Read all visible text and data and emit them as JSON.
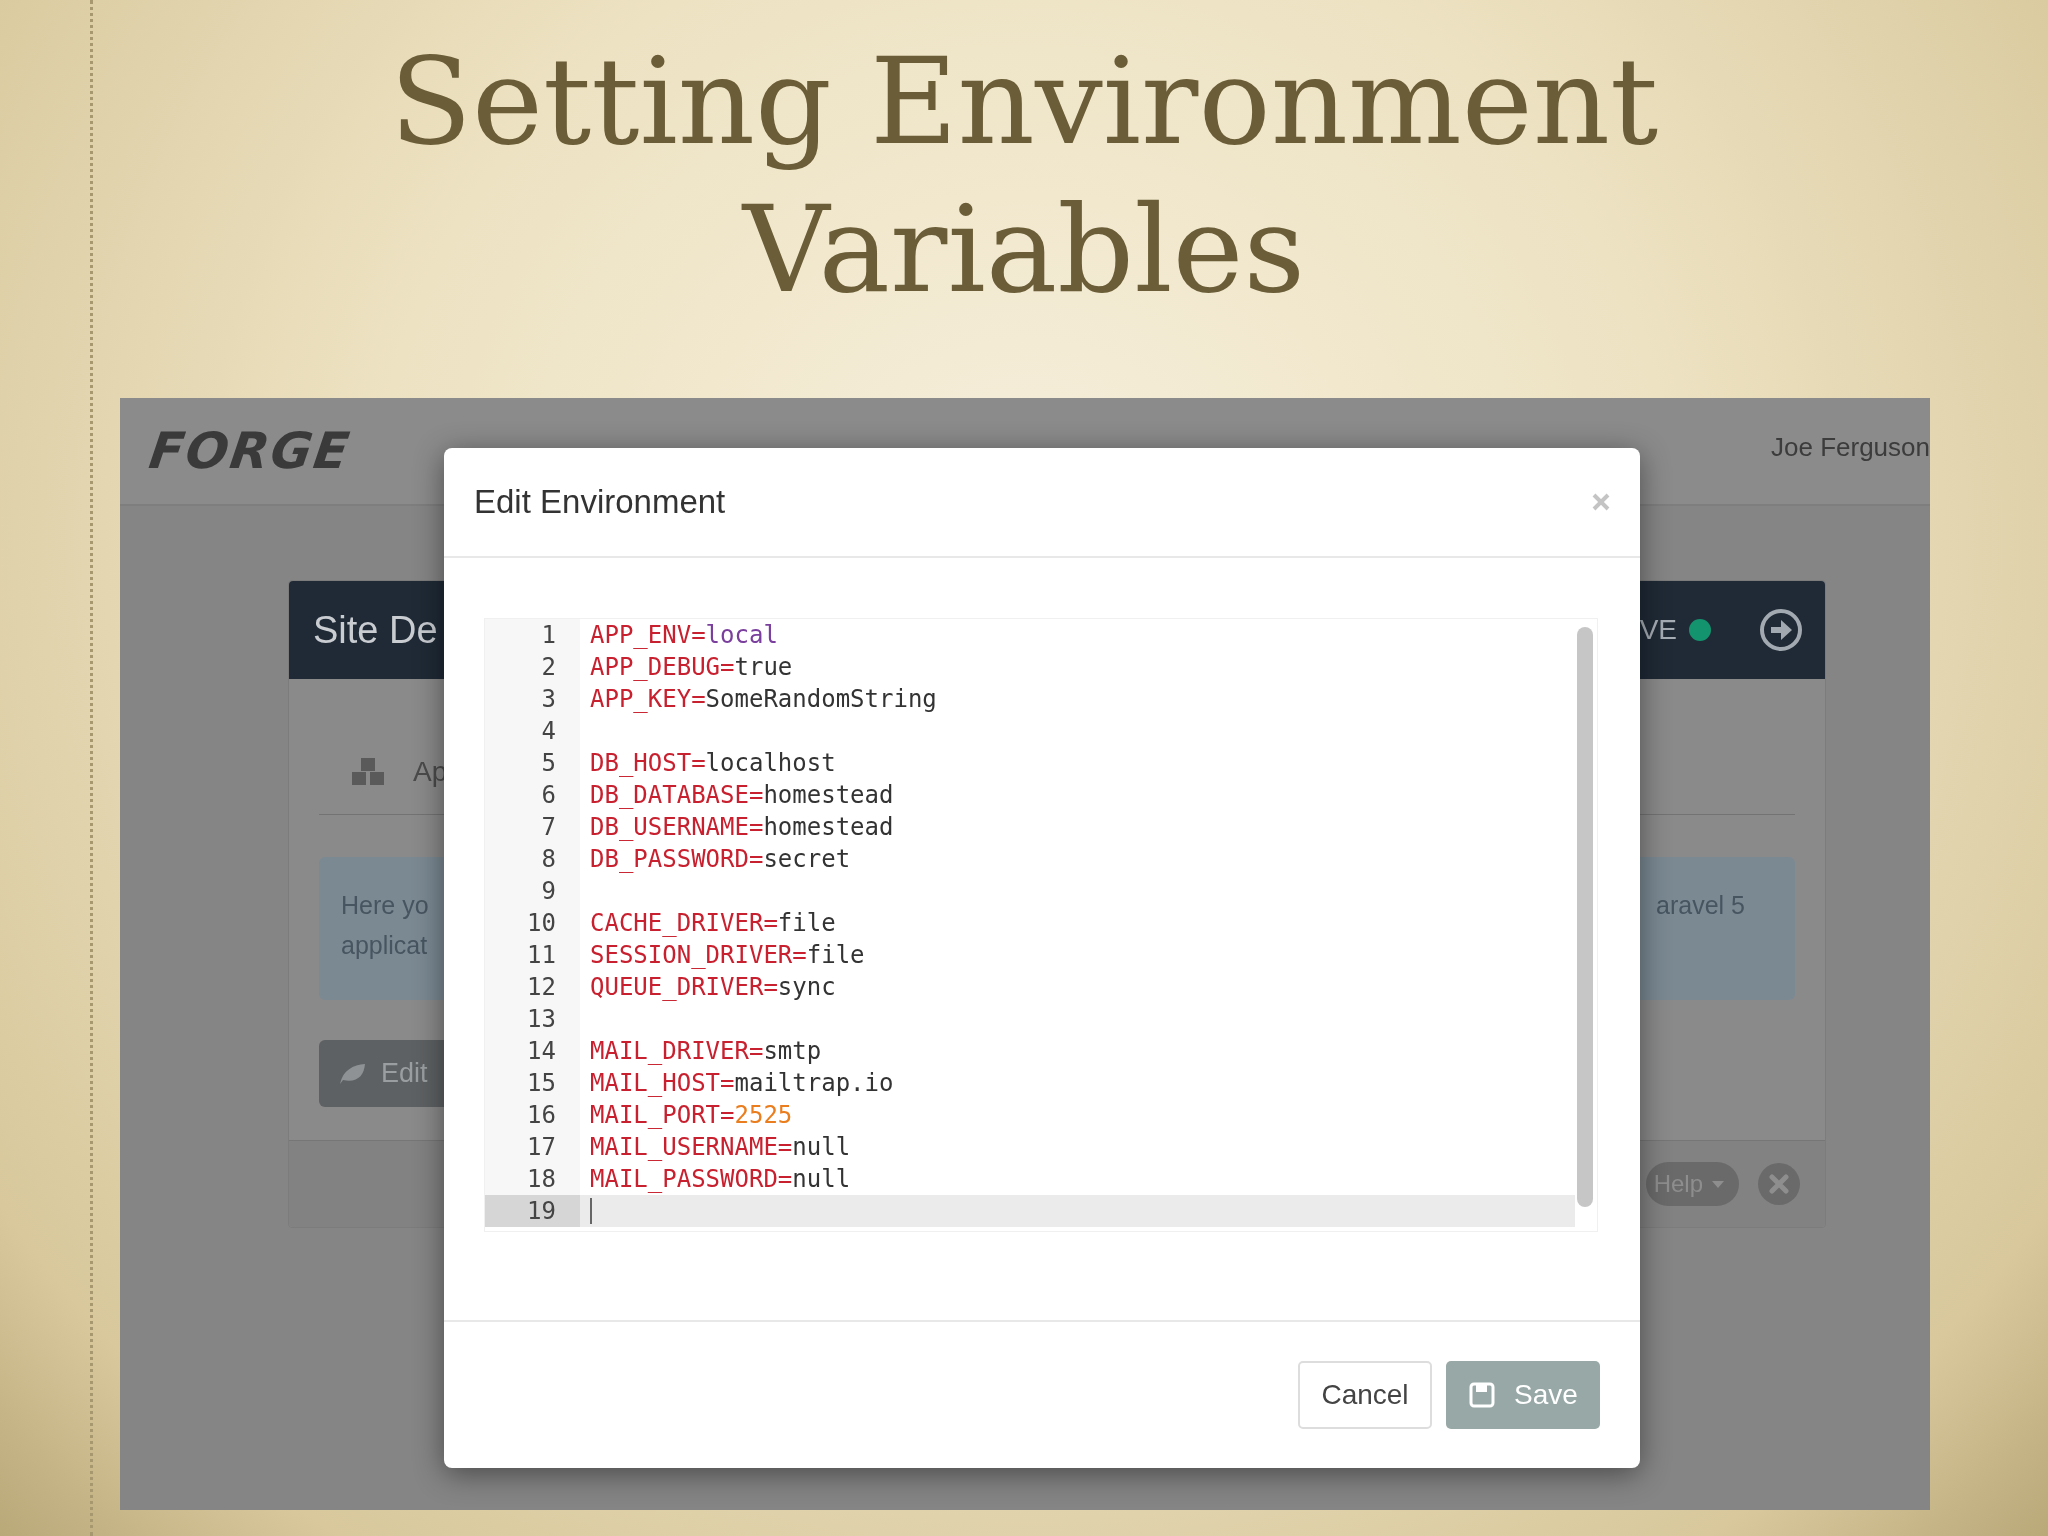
{
  "slide": {
    "title": "Setting Environment Variables"
  },
  "app": {
    "logo": "FORGE",
    "user": "Joe Ferguson"
  },
  "site_card": {
    "title": "Site De",
    "status": "VE",
    "tab": "Ap",
    "alert": {
      "line_1": "Here yo",
      "line_2": "applicat",
      "right": "aravel 5"
    },
    "edit_button": "Edit",
    "help_button": "Help"
  },
  "modal": {
    "title": "Edit Environment",
    "lines": [
      {
        "number": "1",
        "key": "APP_ENV=",
        "value": "local",
        "kind": "atom",
        "active": false
      },
      {
        "number": "2",
        "key": "APP_DEBUG=",
        "value": "true",
        "kind": "text",
        "active": false
      },
      {
        "number": "3",
        "key": "APP_KEY=",
        "value": "SomeRandomString",
        "kind": "text",
        "active": false
      },
      {
        "number": "4",
        "active": false
      },
      {
        "number": "5",
        "key": "DB_HOST=",
        "value": "localhost",
        "kind": "text",
        "active": false
      },
      {
        "number": "6",
        "key": "DB_DATABASE=",
        "value": "homestead",
        "kind": "text",
        "active": false
      },
      {
        "number": "7",
        "key": "DB_USERNAME=",
        "value": "homestead",
        "kind": "text",
        "active": false
      },
      {
        "number": "8",
        "key": "DB_PASSWORD=",
        "value": "secret",
        "kind": "text",
        "active": false
      },
      {
        "number": "9",
        "active": false
      },
      {
        "number": "10",
        "key": "CACHE_DRIVER=",
        "value": "file",
        "kind": "text",
        "active": false
      },
      {
        "number": "11",
        "key": "SESSION_DRIVER=",
        "value": "file",
        "kind": "text",
        "active": false
      },
      {
        "number": "12",
        "key": "QUEUE_DRIVER=",
        "value": "sync",
        "kind": "text",
        "active": false
      },
      {
        "number": "13",
        "active": false
      },
      {
        "number": "14",
        "key": "MAIL_DRIVER=",
        "value": "smtp",
        "kind": "text",
        "active": false
      },
      {
        "number": "15",
        "key": "MAIL_HOST=",
        "value": "mailtrap.io",
        "kind": "text",
        "active": false
      },
      {
        "number": "16",
        "key": "MAIL_PORT=",
        "value": "2525",
        "kind": "number",
        "active": false
      },
      {
        "number": "17",
        "key": "MAIL_USERNAME=",
        "value": "null",
        "kind": "text",
        "active": false
      },
      {
        "number": "18",
        "key": "MAIL_PASSWORD=",
        "value": "null",
        "kind": "text",
        "active": false
      },
      {
        "number": "19",
        "active": true
      }
    ],
    "cancel_button": "Cancel",
    "save_button": "Save"
  }
}
